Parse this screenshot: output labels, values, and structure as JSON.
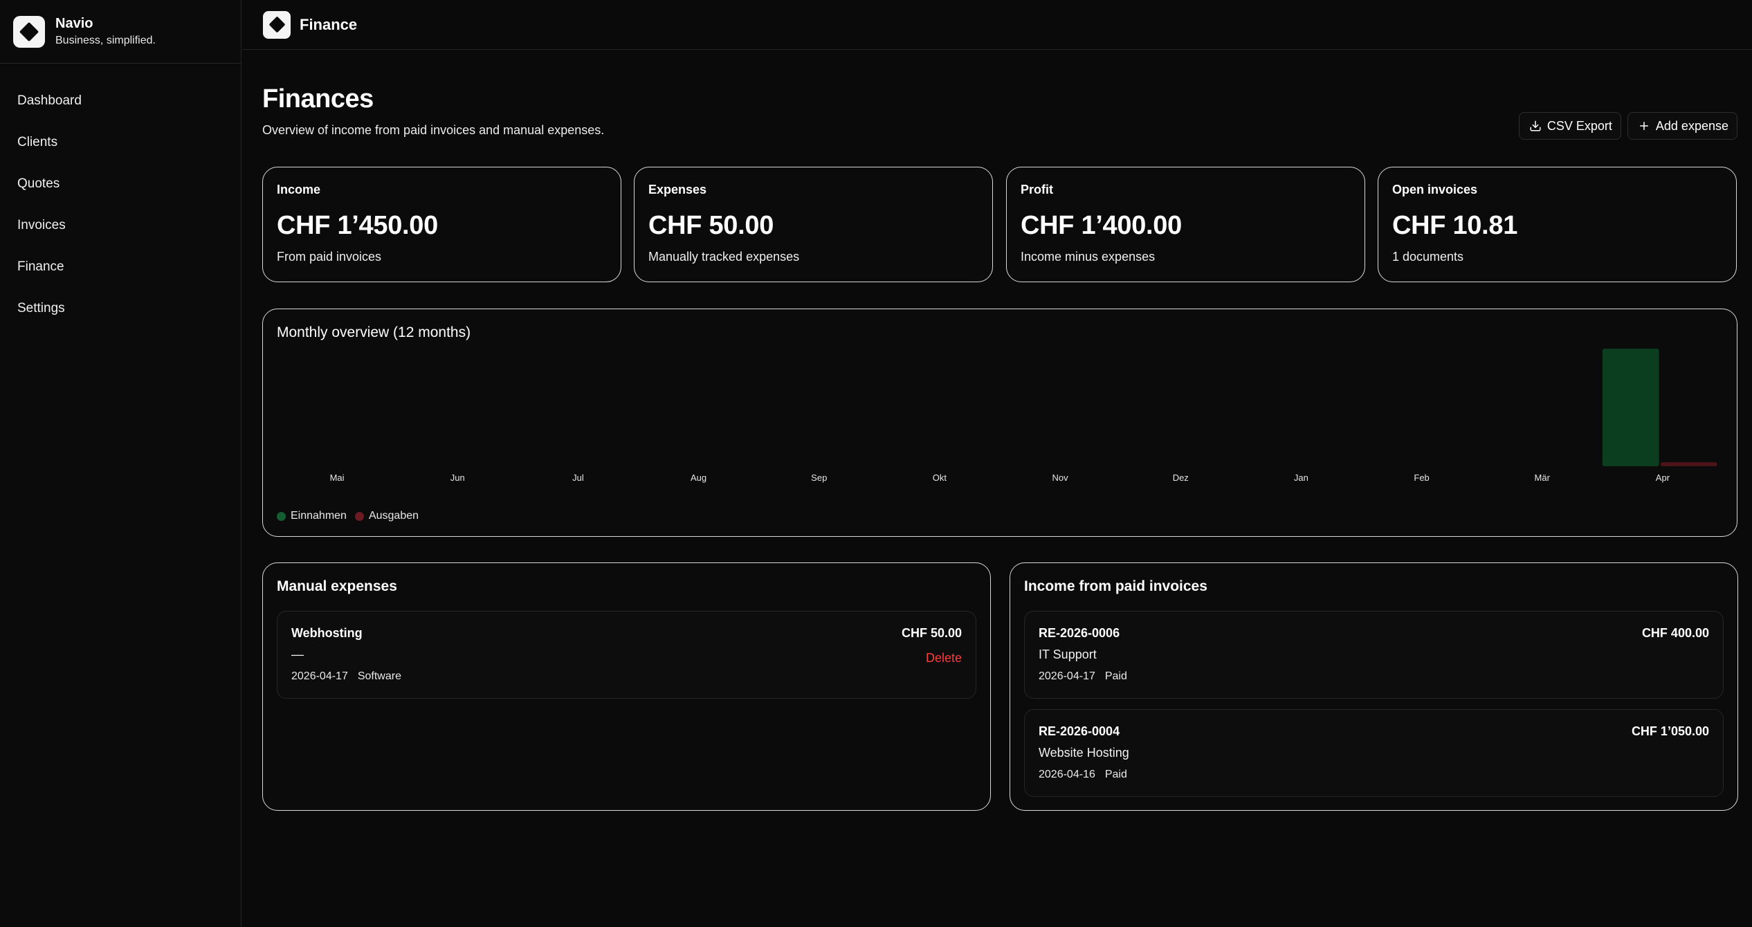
{
  "app": {
    "name": "Navio",
    "tagline": "Business, simplified."
  },
  "sidebar": {
    "items": [
      {
        "label": "Dashboard"
      },
      {
        "label": "Clients"
      },
      {
        "label": "Quotes"
      },
      {
        "label": "Invoices"
      },
      {
        "label": "Finance"
      },
      {
        "label": "Settings"
      }
    ]
  },
  "topbar": {
    "title": "Finance"
  },
  "page": {
    "title": "Finances",
    "subtitle": "Overview of income from paid invoices and manual expenses.",
    "csv_export_label": "CSV Export",
    "add_expense_label": "Add expense"
  },
  "stats": [
    {
      "label": "Income",
      "value": "CHF 1’450.00",
      "desc": "From paid invoices"
    },
    {
      "label": "Expenses",
      "value": "CHF 50.00",
      "desc": "Manually tracked expenses"
    },
    {
      "label": "Profit",
      "value": "CHF 1’400.00",
      "desc": "Income minus expenses"
    },
    {
      "label": "Open invoices",
      "value": "CHF 10.81",
      "desc": "1 documents"
    }
  ],
  "chart_data": {
    "type": "bar",
    "title": "Monthly overview (12 months)",
    "categories": [
      "Mai",
      "Jun",
      "Jul",
      "Aug",
      "Sep",
      "Okt",
      "Nov",
      "Dez",
      "Jan",
      "Feb",
      "Mär",
      "Apr"
    ],
    "series": [
      {
        "name": "Einnahmen",
        "color": "#0b3d1f",
        "values": [
          0,
          0,
          0,
          0,
          0,
          0,
          0,
          0,
          0,
          0,
          0,
          1450
        ]
      },
      {
        "name": "Ausgaben",
        "color": "#4a1418",
        "values": [
          0,
          0,
          0,
          0,
          0,
          0,
          0,
          0,
          0,
          0,
          0,
          50
        ]
      }
    ],
    "ylim": [
      0,
      1450
    ],
    "grid": false,
    "legend_position": "bottom-left"
  },
  "expenses": {
    "title": "Manual expenses",
    "items": [
      {
        "name": "Webhosting",
        "amount": "CHF 50.00",
        "note": "—",
        "date": "2026-04-17",
        "category": "Software",
        "delete_label": "Delete"
      }
    ]
  },
  "income": {
    "title": "Income from paid invoices",
    "items": [
      {
        "number": "RE-2026-0006",
        "amount": "CHF 400.00",
        "title": "IT Support",
        "date": "2026-04-17",
        "status": "Paid"
      },
      {
        "number": "RE-2026-0004",
        "amount": "CHF 1’050.00",
        "title": "Website Hosting",
        "date": "2026-04-16",
        "status": "Paid"
      }
    ]
  }
}
